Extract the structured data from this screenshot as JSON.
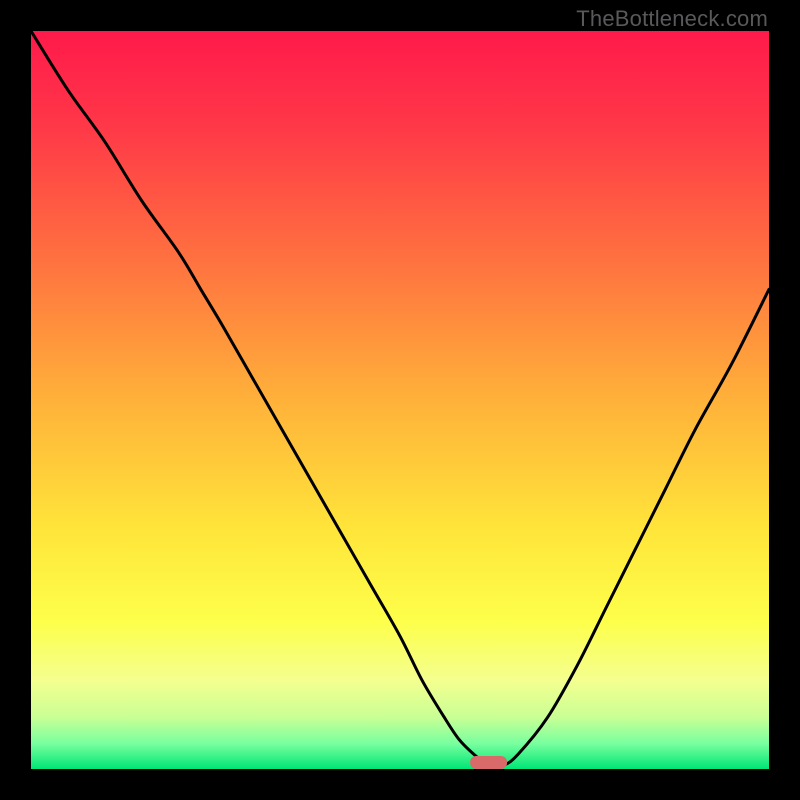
{
  "watermark": "TheBottleneck.com",
  "chart_data": {
    "type": "line",
    "title": "",
    "xlabel": "",
    "ylabel": "",
    "xlim": [
      0,
      100
    ],
    "ylim": [
      0,
      100
    ],
    "series": [
      {
        "name": "bottleneck-curve",
        "x": [
          0,
          5,
          10,
          15,
          20,
          23,
          26,
          30,
          34,
          38,
          42,
          46,
          50,
          53,
          56,
          58,
          60,
          62,
          64,
          66,
          70,
          74,
          78,
          82,
          86,
          90,
          95,
          100
        ],
        "y": [
          100,
          92,
          85,
          77,
          70,
          65,
          60,
          53,
          46,
          39,
          32,
          25,
          18,
          12,
          7,
          4,
          2,
          0.5,
          0.5,
          2,
          7,
          14,
          22,
          30,
          38,
          46,
          55,
          65
        ]
      }
    ],
    "marker": {
      "x": 62,
      "width": 5,
      "color": "#d86b6a"
    },
    "background": {
      "stops": [
        {
          "offset": 0.0,
          "color": "#ff1a4b"
        },
        {
          "offset": 0.12,
          "color": "#ff3548"
        },
        {
          "offset": 0.3,
          "color": "#ff6e40"
        },
        {
          "offset": 0.5,
          "color": "#ffb13a"
        },
        {
          "offset": 0.68,
          "color": "#ffe63a"
        },
        {
          "offset": 0.8,
          "color": "#fdff4a"
        },
        {
          "offset": 0.88,
          "color": "#f4ff8f"
        },
        {
          "offset": 0.93,
          "color": "#c9ff95"
        },
        {
          "offset": 0.965,
          "color": "#7aff9f"
        },
        {
          "offset": 1.0,
          "color": "#00e676"
        }
      ]
    }
  }
}
